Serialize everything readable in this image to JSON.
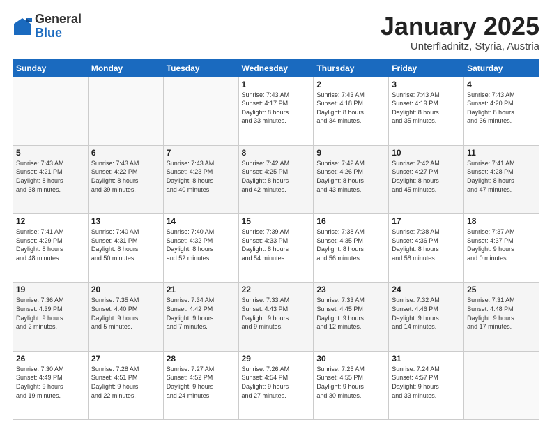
{
  "logo": {
    "general": "General",
    "blue": "Blue"
  },
  "header": {
    "title": "January 2025",
    "location": "Unterfladnitz, Styria, Austria"
  },
  "weekdays": [
    "Sunday",
    "Monday",
    "Tuesday",
    "Wednesday",
    "Thursday",
    "Friday",
    "Saturday"
  ],
  "weeks": [
    [
      {
        "day": "",
        "info": ""
      },
      {
        "day": "",
        "info": ""
      },
      {
        "day": "",
        "info": ""
      },
      {
        "day": "1",
        "info": "Sunrise: 7:43 AM\nSunset: 4:17 PM\nDaylight: 8 hours\nand 33 minutes."
      },
      {
        "day": "2",
        "info": "Sunrise: 7:43 AM\nSunset: 4:18 PM\nDaylight: 8 hours\nand 34 minutes."
      },
      {
        "day": "3",
        "info": "Sunrise: 7:43 AM\nSunset: 4:19 PM\nDaylight: 8 hours\nand 35 minutes."
      },
      {
        "day": "4",
        "info": "Sunrise: 7:43 AM\nSunset: 4:20 PM\nDaylight: 8 hours\nand 36 minutes."
      }
    ],
    [
      {
        "day": "5",
        "info": "Sunrise: 7:43 AM\nSunset: 4:21 PM\nDaylight: 8 hours\nand 38 minutes."
      },
      {
        "day": "6",
        "info": "Sunrise: 7:43 AM\nSunset: 4:22 PM\nDaylight: 8 hours\nand 39 minutes."
      },
      {
        "day": "7",
        "info": "Sunrise: 7:43 AM\nSunset: 4:23 PM\nDaylight: 8 hours\nand 40 minutes."
      },
      {
        "day": "8",
        "info": "Sunrise: 7:42 AM\nSunset: 4:25 PM\nDaylight: 8 hours\nand 42 minutes."
      },
      {
        "day": "9",
        "info": "Sunrise: 7:42 AM\nSunset: 4:26 PM\nDaylight: 8 hours\nand 43 minutes."
      },
      {
        "day": "10",
        "info": "Sunrise: 7:42 AM\nSunset: 4:27 PM\nDaylight: 8 hours\nand 45 minutes."
      },
      {
        "day": "11",
        "info": "Sunrise: 7:41 AM\nSunset: 4:28 PM\nDaylight: 8 hours\nand 47 minutes."
      }
    ],
    [
      {
        "day": "12",
        "info": "Sunrise: 7:41 AM\nSunset: 4:29 PM\nDaylight: 8 hours\nand 48 minutes."
      },
      {
        "day": "13",
        "info": "Sunrise: 7:40 AM\nSunset: 4:31 PM\nDaylight: 8 hours\nand 50 minutes."
      },
      {
        "day": "14",
        "info": "Sunrise: 7:40 AM\nSunset: 4:32 PM\nDaylight: 8 hours\nand 52 minutes."
      },
      {
        "day": "15",
        "info": "Sunrise: 7:39 AM\nSunset: 4:33 PM\nDaylight: 8 hours\nand 54 minutes."
      },
      {
        "day": "16",
        "info": "Sunrise: 7:38 AM\nSunset: 4:35 PM\nDaylight: 8 hours\nand 56 minutes."
      },
      {
        "day": "17",
        "info": "Sunrise: 7:38 AM\nSunset: 4:36 PM\nDaylight: 8 hours\nand 58 minutes."
      },
      {
        "day": "18",
        "info": "Sunrise: 7:37 AM\nSunset: 4:37 PM\nDaylight: 9 hours\nand 0 minutes."
      }
    ],
    [
      {
        "day": "19",
        "info": "Sunrise: 7:36 AM\nSunset: 4:39 PM\nDaylight: 9 hours\nand 2 minutes."
      },
      {
        "day": "20",
        "info": "Sunrise: 7:35 AM\nSunset: 4:40 PM\nDaylight: 9 hours\nand 5 minutes."
      },
      {
        "day": "21",
        "info": "Sunrise: 7:34 AM\nSunset: 4:42 PM\nDaylight: 9 hours\nand 7 minutes."
      },
      {
        "day": "22",
        "info": "Sunrise: 7:33 AM\nSunset: 4:43 PM\nDaylight: 9 hours\nand 9 minutes."
      },
      {
        "day": "23",
        "info": "Sunrise: 7:33 AM\nSunset: 4:45 PM\nDaylight: 9 hours\nand 12 minutes."
      },
      {
        "day": "24",
        "info": "Sunrise: 7:32 AM\nSunset: 4:46 PM\nDaylight: 9 hours\nand 14 minutes."
      },
      {
        "day": "25",
        "info": "Sunrise: 7:31 AM\nSunset: 4:48 PM\nDaylight: 9 hours\nand 17 minutes."
      }
    ],
    [
      {
        "day": "26",
        "info": "Sunrise: 7:30 AM\nSunset: 4:49 PM\nDaylight: 9 hours\nand 19 minutes."
      },
      {
        "day": "27",
        "info": "Sunrise: 7:28 AM\nSunset: 4:51 PM\nDaylight: 9 hours\nand 22 minutes."
      },
      {
        "day": "28",
        "info": "Sunrise: 7:27 AM\nSunset: 4:52 PM\nDaylight: 9 hours\nand 24 minutes."
      },
      {
        "day": "29",
        "info": "Sunrise: 7:26 AM\nSunset: 4:54 PM\nDaylight: 9 hours\nand 27 minutes."
      },
      {
        "day": "30",
        "info": "Sunrise: 7:25 AM\nSunset: 4:55 PM\nDaylight: 9 hours\nand 30 minutes."
      },
      {
        "day": "31",
        "info": "Sunrise: 7:24 AM\nSunset: 4:57 PM\nDaylight: 9 hours\nand 33 minutes."
      },
      {
        "day": "",
        "info": ""
      }
    ]
  ]
}
